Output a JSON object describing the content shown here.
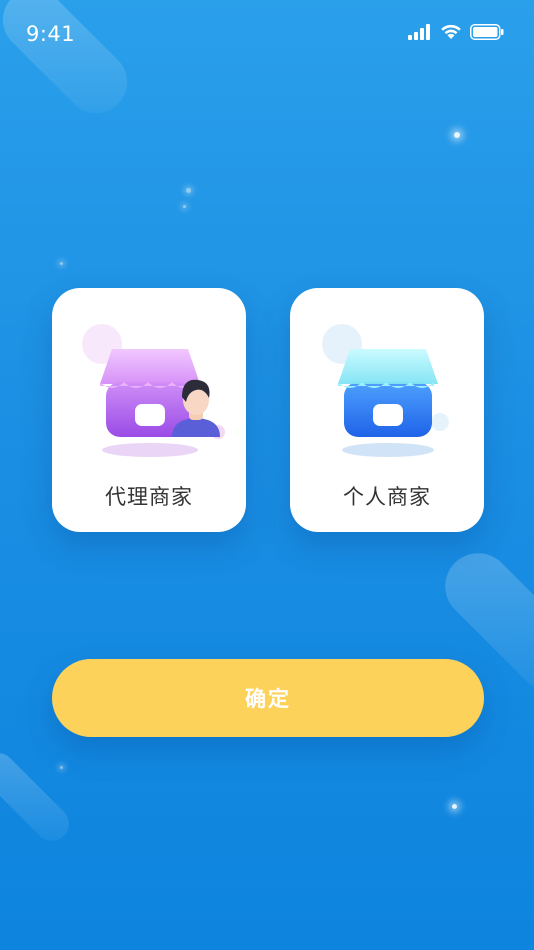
{
  "status_bar": {
    "time": "9:41",
    "icons": [
      "signal-icon",
      "wifi-icon",
      "battery-icon"
    ]
  },
  "merchant_types": [
    {
      "label": "代理商家",
      "icon": "agent-store-icon",
      "color": "#b56cf0"
    },
    {
      "label": "个人商家",
      "icon": "personal-store-icon",
      "color": "#2f7cf5"
    }
  ],
  "confirm": {
    "label": "确定",
    "color": "#fdd25a"
  },
  "colors": {
    "background": "#1b8fe3",
    "card": "#ffffff",
    "label_text": "#333333"
  }
}
